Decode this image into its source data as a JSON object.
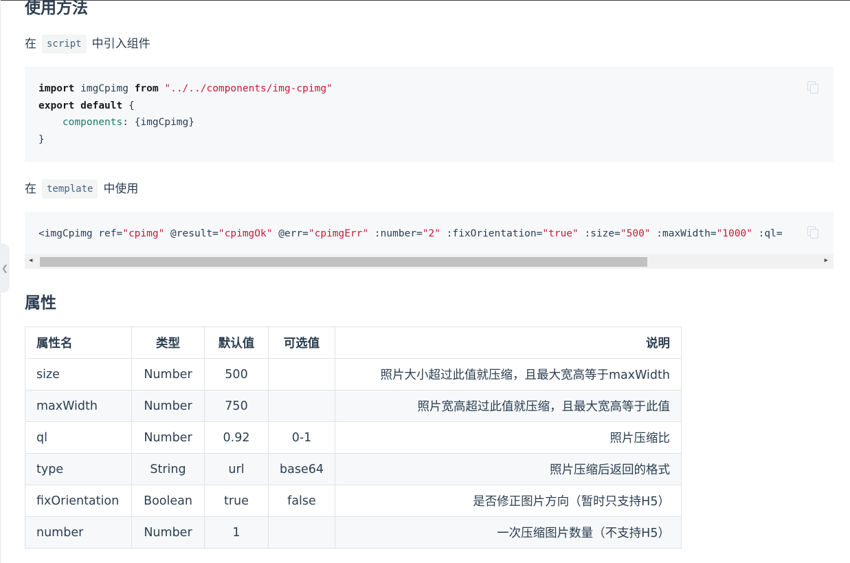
{
  "usage": {
    "title": "使用方法",
    "script_intro": {
      "prefix": "在",
      "code": "script",
      "suffix": "中引入组件"
    },
    "script_code": {
      "line1": {
        "kw1": "import",
        "ident": " imgCpimg ",
        "kw2": "from",
        "str": " \"../../components/img-cpimg\""
      },
      "line2": {
        "kw1": "export",
        "kw2": "default",
        "rest": " {"
      },
      "line3": {
        "indent": "    ",
        "prop": "components",
        "rest": ": {imgCpimg}"
      },
      "line4": "}"
    },
    "template_intro": {
      "prefix": "在",
      "code": "template",
      "suffix": "中使用"
    },
    "template_code": [
      {
        "t": "<imgCpimg ref=",
        "s": false
      },
      {
        "t": "\"cpimg\"",
        "s": true
      },
      {
        "t": " @result=",
        "s": false
      },
      {
        "t": "\"cpimgOk\"",
        "s": true
      },
      {
        "t": " @err=",
        "s": false
      },
      {
        "t": "\"cpimgErr\"",
        "s": true
      },
      {
        "t": " :number=",
        "s": false
      },
      {
        "t": "\"2\"",
        "s": true
      },
      {
        "t": " :fixOrientation=",
        "s": false
      },
      {
        "t": "\"true\"",
        "s": true
      },
      {
        "t": " :size=",
        "s": false
      },
      {
        "t": "\"500\"",
        "s": true
      },
      {
        "t": " :maxWidth=",
        "s": false
      },
      {
        "t": "\"1000\"",
        "s": true
      },
      {
        "t": " :ql=",
        "s": false
      }
    ]
  },
  "props": {
    "title": "属性",
    "headers": [
      "属性名",
      "类型",
      "默认值",
      "可选值",
      "说明"
    ],
    "rows": [
      [
        "size",
        "Number",
        "500",
        "",
        "照片大小超过此值就压缩，且最大宽高等于maxWidth"
      ],
      [
        "maxWidth",
        "Number",
        "750",
        "",
        "照片宽高超过此值就压缩，且最大宽高等于此值"
      ],
      [
        "ql",
        "Number",
        "0.92",
        "0-1",
        "照片压缩比"
      ],
      [
        "type",
        "String",
        "url",
        "base64",
        "照片压缩后返回的格式"
      ],
      [
        "fixOrientation",
        "Boolean",
        "true",
        "false",
        "是否修正图片方向（暂时只支持H5）"
      ],
      [
        "number",
        "Number",
        "1",
        "",
        "一次压缩图片数量（不支持H5）"
      ]
    ]
  },
  "icons": {
    "copy": "copy-icon",
    "sidebar_toggle": "chevron-left-icon",
    "scroll_left": "arrow-left-icon",
    "scroll_right": "arrow-right-icon"
  },
  "scrollbar": {
    "thumb_fraction": 0.78
  }
}
